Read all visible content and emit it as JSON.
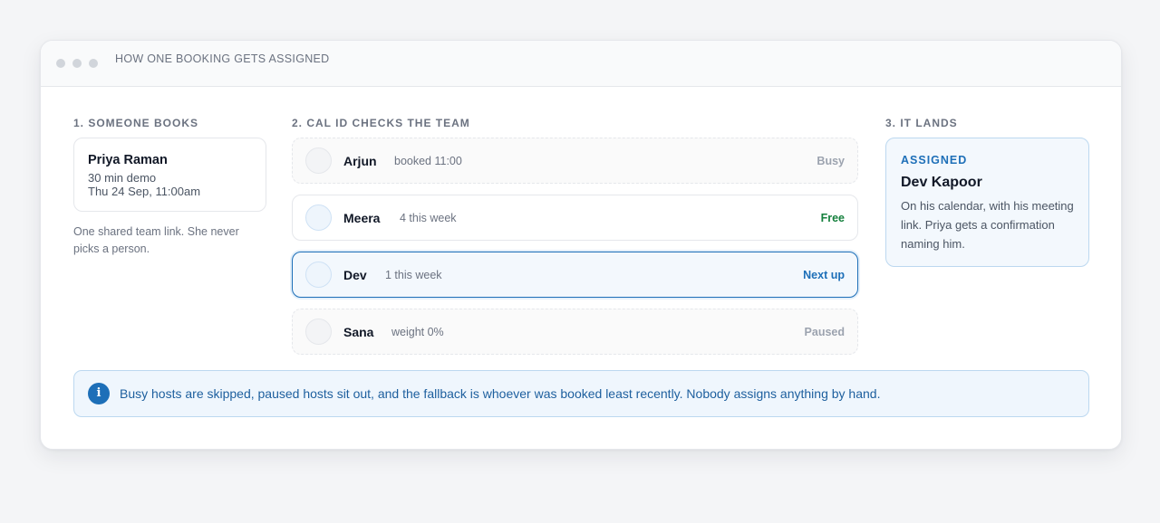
{
  "window": {
    "title": "HOW ONE BOOKING GETS ASSIGNED"
  },
  "steps": {
    "one": {
      "label": "1. SOMEONE BOOKS",
      "booker": {
        "name": "Priya Raman",
        "event": "30 min demo",
        "when": "Thu 24 Sep, 11:00am"
      },
      "note": "One shared team link. She never picks a person."
    },
    "two": {
      "label": "2. CAL ID CHECKS THE TEAM",
      "hosts": [
        {
          "name": "Arjun",
          "meta": "booked 11:00",
          "status": "Busy"
        },
        {
          "name": "Meera",
          "meta": "4 this week",
          "status": "Free"
        },
        {
          "name": "Dev",
          "meta": "1 this week",
          "status": "Next up"
        },
        {
          "name": "Sana",
          "meta": "weight 0%",
          "status": "Paused"
        }
      ]
    },
    "three": {
      "label": "3. IT LANDS",
      "tag": "ASSIGNED",
      "assignee": "Dev Kapoor",
      "description": "On his calendar, with his meeting link. Priya gets a confirmation naming him."
    }
  },
  "banner": {
    "icon": "info-icon",
    "text": "Busy hosts are skipped, paused hosts sit out, and the fallback is whoever was booked least recently. Nobody assigns anything by hand."
  },
  "colors": {
    "accent": "#1d6fb8",
    "free": "#15803d",
    "muted": "#9ca3af"
  }
}
